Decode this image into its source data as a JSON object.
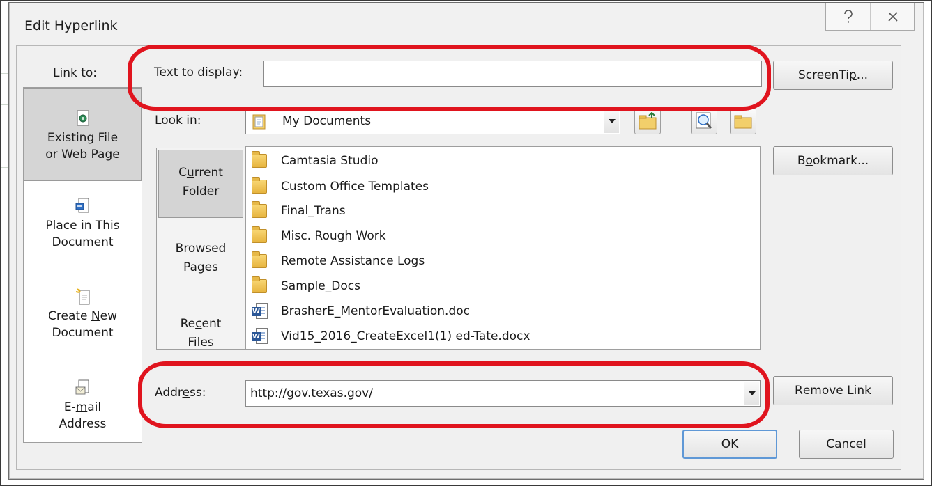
{
  "dialog": {
    "title": "Edit Hyperlink",
    "help_glyph": "?",
    "close_glyph": "☒"
  },
  "link_to": {
    "label": "Link to:",
    "items": [
      {
        "line1": "Existing File",
        "line2": "or Web Page",
        "icon": "existing-file-icon",
        "selected": true
      },
      {
        "line1_pre": "Pl",
        "line1_u": "a",
        "line1_post": "ce in This",
        "line2": "Document",
        "icon": "place-in-document-icon"
      },
      {
        "line1_pre": "Create ",
        "line1_u": "N",
        "line1_post": "ew",
        "line2": "Document",
        "icon": "create-new-document-icon"
      },
      {
        "line1": "E-",
        "line1_u": "m",
        "line1_post": "ail",
        "line2": "Address",
        "icon": "email-address-icon"
      }
    ]
  },
  "text_to_display": {
    "label_u": "T",
    "label_rest": "ext to display:",
    "value": ""
  },
  "look_in": {
    "label_u": "L",
    "label_rest": "ook in:",
    "value": "My Documents"
  },
  "nav": {
    "tabs": [
      {
        "l1_pre": "C",
        "l1_u": "u",
        "l1_post": "rrent",
        "l2": "Folder",
        "selected": true
      },
      {
        "l1_pre": "",
        "l1_u": "B",
        "l1_post": "rowsed",
        "l2": "Pages"
      },
      {
        "l1_pre": "Re",
        "l1_u": "c",
        "l1_post": "ent",
        "l2": "Files"
      }
    ]
  },
  "files": [
    {
      "name": "Camtasia Studio",
      "type": "folder"
    },
    {
      "name": "Custom Office Templates",
      "type": "folder"
    },
    {
      "name": "Final_Trans",
      "type": "folder"
    },
    {
      "name": "Misc. Rough Work",
      "type": "folder"
    },
    {
      "name": "Remote Assistance Logs",
      "type": "folder"
    },
    {
      "name": "Sample_Docs",
      "type": "folder"
    },
    {
      "name": "BrasherE_MentorEvaluation.doc",
      "type": "word-doc"
    },
    {
      "name": "Vid15_2016_CreateExcel1(1) ed-Tate.docx",
      "type": "word-doc"
    }
  ],
  "address": {
    "label_pre": "Addr",
    "label_u": "e",
    "label_post": "ss:",
    "value": "http://gov.texas.gov/"
  },
  "buttons": {
    "screentip_pre": "ScreenTi",
    "screentip_u": "p",
    "screentip_post": "...",
    "bookmark_pre": "B",
    "bookmark_u": "o",
    "bookmark_post": "okmark...",
    "remove_u": "R",
    "remove_post": "emove Link",
    "ok": "OK",
    "cancel": "Cancel"
  },
  "colors": {
    "annotation": "#e0141e",
    "ok_focus": "#5f98d6"
  }
}
